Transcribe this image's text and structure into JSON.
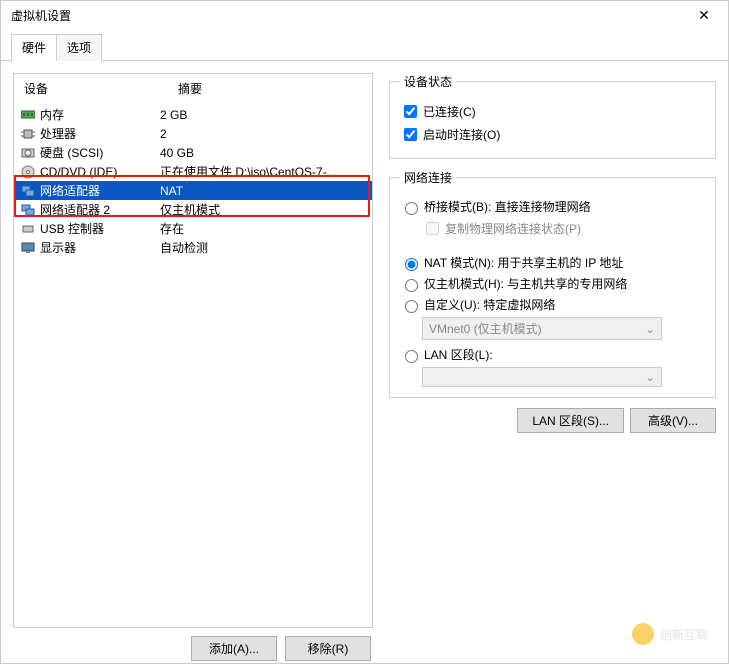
{
  "window": {
    "title": "虚拟机设置",
    "close": "✕"
  },
  "tabs": {
    "hardware": "硬件",
    "options": "选项"
  },
  "deviceHeader": {
    "device": "设备",
    "summary": "摘要"
  },
  "devices": [
    {
      "icon": "memory",
      "name": "内存",
      "summary": "2 GB"
    },
    {
      "icon": "cpu",
      "name": "处理器",
      "summary": "2"
    },
    {
      "icon": "hdd",
      "name": "硬盘 (SCSI)",
      "summary": "40 GB"
    },
    {
      "icon": "cd",
      "name": "CD/DVD (IDE)",
      "summary": "正在使用文件 D:\\iso\\CentOS-7-..."
    },
    {
      "icon": "net",
      "name": "网络适配器",
      "summary": "NAT"
    },
    {
      "icon": "net",
      "name": "网络适配器 2",
      "summary": "仅主机模式"
    },
    {
      "icon": "usb",
      "name": "USB 控制器",
      "summary": "存在"
    },
    {
      "icon": "display",
      "name": "显示器",
      "summary": "自动检测"
    }
  ],
  "buttons": {
    "add": "添加(A)...",
    "remove": "移除(R)"
  },
  "status": {
    "legend": "设备状态",
    "connected": "已连接(C)",
    "connectOnPower": "启动时连接(O)"
  },
  "net": {
    "legend": "网络连接",
    "bridged": "桥接模式(B): 直接连接物理网络",
    "replicate": "复制物理网络连接状态(P)",
    "nat": "NAT 模式(N): 用于共享主机的 IP 地址",
    "hostonly": "仅主机模式(H): 与主机共享的专用网络",
    "custom": "自定义(U): 特定虚拟网络",
    "customCombo": "VMnet0 (仅主机模式)",
    "lan": "LAN 区段(L):",
    "lanBtn": "LAN 区段(S)...",
    "advBtn": "高级(V)..."
  },
  "watermark": "创新互联"
}
